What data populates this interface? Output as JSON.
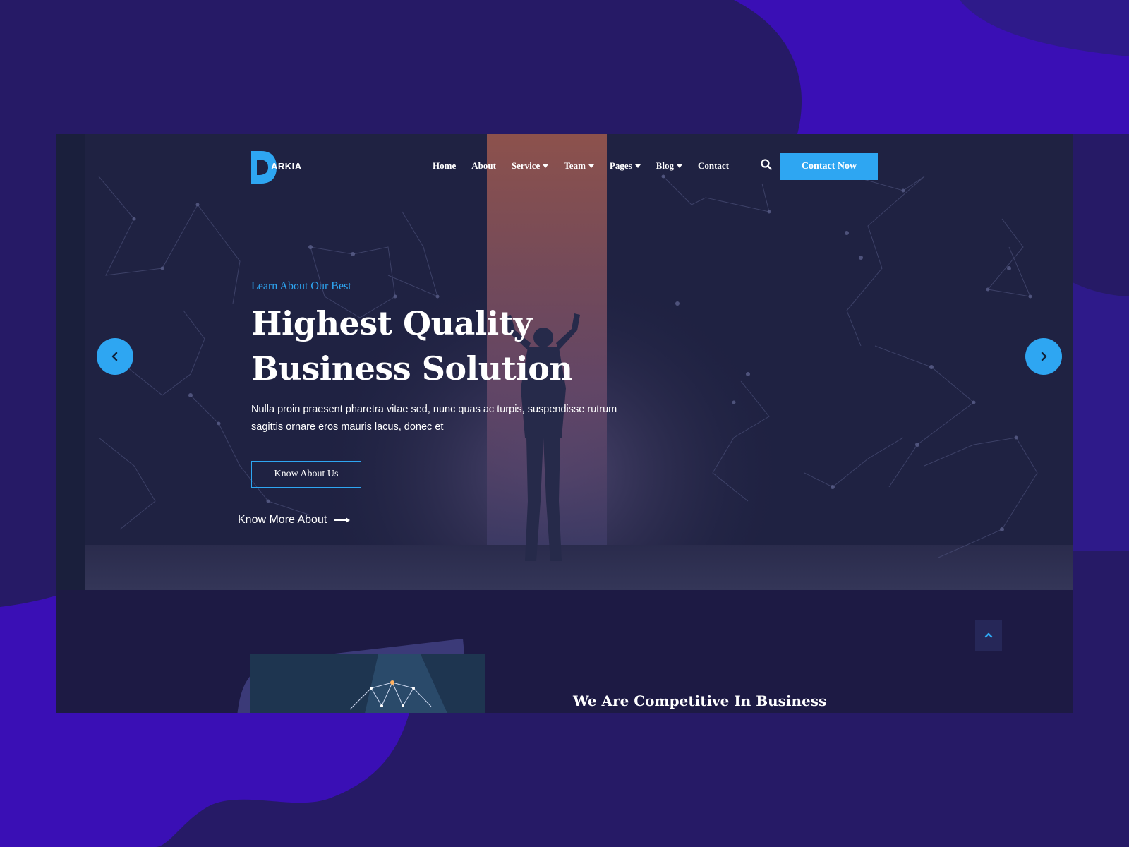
{
  "brand": {
    "logo_letter": "D",
    "logo_text": "ARKIA",
    "accent": "#2ea6f2"
  },
  "nav": {
    "items": [
      {
        "label": "Home",
        "dropdown": false
      },
      {
        "label": "About",
        "dropdown": false
      },
      {
        "label": "Service",
        "dropdown": true
      },
      {
        "label": "Team",
        "dropdown": true
      },
      {
        "label": "Pages",
        "dropdown": true
      },
      {
        "label": "Blog",
        "dropdown": true
      },
      {
        "label": "Contact",
        "dropdown": false
      }
    ],
    "search_icon": "search-icon",
    "cta_label": "Contact Now"
  },
  "hero": {
    "kicker": "Learn About Our Best",
    "headline_line1": "Highest Quality",
    "headline_line2": "Business Solution",
    "lead": "Nulla proin praesent pharetra vitae sed, nunc quas ac turpis, suspendisse rutrum sagittis ornare eros mauris lacus, donec et",
    "button_label": "Know About Us",
    "link_label": "Know More About",
    "prev_icon": "chevron-left-icon",
    "next_icon": "chevron-right-icon"
  },
  "about": {
    "title": "We Are Competitive In Business Solutions"
  },
  "scroll_top_icon": "chevron-up-icon"
}
